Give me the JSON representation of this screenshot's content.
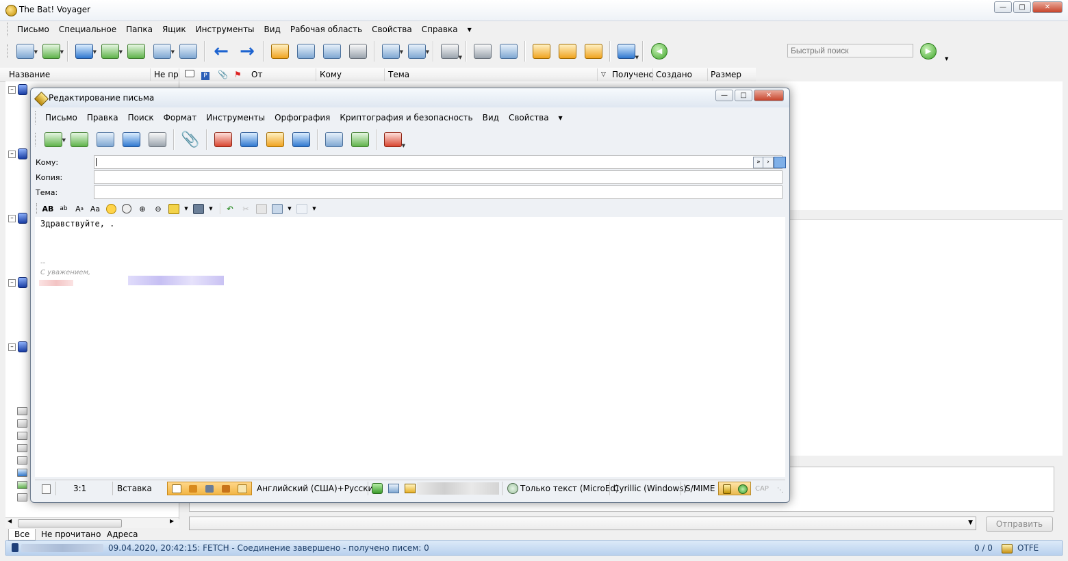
{
  "app": {
    "title": "The Bat! Voyager"
  },
  "main_menu": [
    "Письмо",
    "Специальное",
    "Папка",
    "Ящик",
    "Инструменты",
    "Вид",
    "Рабочая область",
    "Свойства",
    "Справка"
  ],
  "search": {
    "placeholder": "Быстрый поиск"
  },
  "columns": {
    "name": "Название",
    "unread": "Не пр",
    "from": "От",
    "to": "Кому",
    "subject": "Тема",
    "received": "Получено",
    "created": "Создано",
    "size": "Размер"
  },
  "bottom_tabs": [
    "Все",
    "Не прочитано",
    "Адреса"
  ],
  "reply": {
    "send_label": "Отправить"
  },
  "status": {
    "message": "09.04.2020, 20:42:15: FETCH - Соединение завершено - получено писем: 0",
    "counter": "0 / 0",
    "otfe": "OTFE"
  },
  "compose": {
    "title": "Редактирование письма",
    "menu": [
      "Письмо",
      "Правка",
      "Поиск",
      "Формат",
      "Инструменты",
      "Орфография",
      "Криптография и безопасность",
      "Вид",
      "Свойства"
    ],
    "labels": {
      "to": "Кому:",
      "cc": "Копия:",
      "subject": "Тема:"
    },
    "body": {
      "greeting": "Здравствуйте, .",
      "sig_dashes": "--",
      "regards": "С уважением,"
    },
    "status": {
      "position": "3:1",
      "mode": "Вставка",
      "language": "Английский (США)+Русский",
      "text_mode": "Только текст (MicroEd)",
      "encoding": "Cyrillic (Windows)",
      "smime": "S/MIME",
      "cap": "CAP"
    }
  },
  "colors": {
    "accent": "#1d63d0",
    "status_bar": "#b9d1ee",
    "insert_mode": "#f2b544"
  }
}
